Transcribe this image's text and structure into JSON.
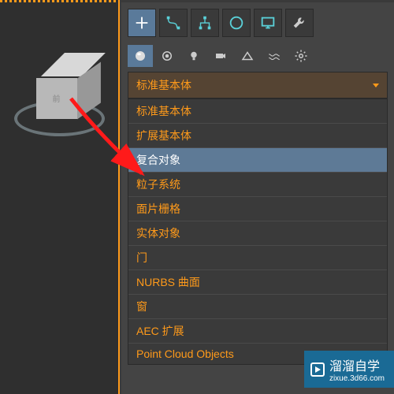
{
  "dropdown": {
    "header": "标准基本体",
    "items": [
      "标准基本体",
      "扩展基本体",
      "复合对象",
      "粒子系统",
      "面片栅格",
      "实体对象",
      "门",
      "NURBS 曲面",
      "窗",
      "AEC 扩展",
      "Point Cloud Objects"
    ],
    "selectedIndex": 2
  },
  "watermark": {
    "main": "溜溜自学",
    "sub": "zixue.3d66.com"
  },
  "toolbar1": [
    "plus-icon",
    "bezier-icon",
    "link-icon",
    "circle-icon",
    "monitor-icon",
    "wrench-icon"
  ],
  "toolbar2": [
    "sphere-icon",
    "shape-icon",
    "light-icon",
    "camera-icon",
    "helper-icon",
    "wave-icon",
    "gear-icon"
  ]
}
